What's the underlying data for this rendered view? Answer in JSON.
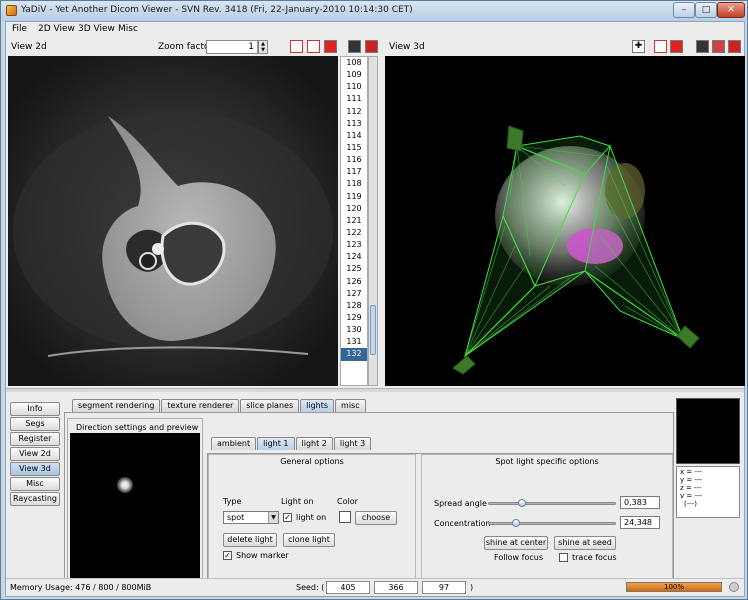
{
  "window": {
    "title": "YaDiV - Yet Another Dicom Viewer - SVN Rev. 3418 (Fri, 22-January-2010 10:14:30 CET)",
    "minimize": "–",
    "maximize": "□",
    "close": "✕"
  },
  "menu": [
    "File",
    "2D View",
    "3D View",
    "Misc"
  ],
  "view2d": {
    "label": "View 2d",
    "zoom_label": "Zoom factor:",
    "zoom_value": "1",
    "slices": [
      "108",
      "109",
      "110",
      "111",
      "112",
      "113",
      "114",
      "115",
      "116",
      "117",
      "118",
      "119",
      "120",
      "121",
      "122",
      "123",
      "124",
      "125",
      "126",
      "127",
      "128",
      "129",
      "130",
      "131",
      "132"
    ],
    "selected_slice": "132"
  },
  "view3d": {
    "label": "View 3d"
  },
  "side_buttons": [
    "Info",
    "Segs",
    "Register",
    "View 2d",
    "View 3d",
    "Misc",
    "Raycasting"
  ],
  "active_side_button": "View 3d",
  "main_tabs": [
    "segment rendering",
    "texture renderer",
    "slice planes",
    "lights",
    "misc"
  ],
  "active_main_tab": "lights",
  "preview_title": "Direction settings and preview",
  "light_tabs": [
    "ambient",
    "light 1",
    "light 2",
    "light 3"
  ],
  "active_light_tab": "light 1",
  "general": {
    "title": "General options",
    "type_label": "Type",
    "type_value": "spot",
    "light_on_label": "Light on",
    "light_on_checkbox": "light on",
    "color_label": "Color",
    "choose_button": "choose",
    "delete_button": "delete light",
    "clone_button": "clone light",
    "show_marker": "Show marker"
  },
  "spot": {
    "title": "Spot light specific options",
    "spread_label": "Spread angle",
    "spread_value": "0,383",
    "spread_fraction": 0.25,
    "concentration_label": "Concentration",
    "concentration_value": "24,348",
    "concentration_fraction": 0.2,
    "shine_center": "shine at center",
    "shine_seed": "shine at seed",
    "follow_focus": "Follow focus",
    "trace_focus": "trace focus"
  },
  "coords": [
    "x = ---",
    "y = ---",
    "z = ---",
    "v = ---",
    "(---)"
  ],
  "status": {
    "memory": "Memory Usage:  476 / 800 / 800MiB",
    "seed_label": "Seed: (",
    "seed": [
      "405",
      "366",
      "97"
    ],
    "sep": ",",
    "close_paren": ")",
    "progress_text": "100%",
    "progress_fraction": 1.0
  },
  "colors": {
    "wireframe": "#44dd44",
    "selection": "#336699",
    "progress": "#e07f1f"
  }
}
